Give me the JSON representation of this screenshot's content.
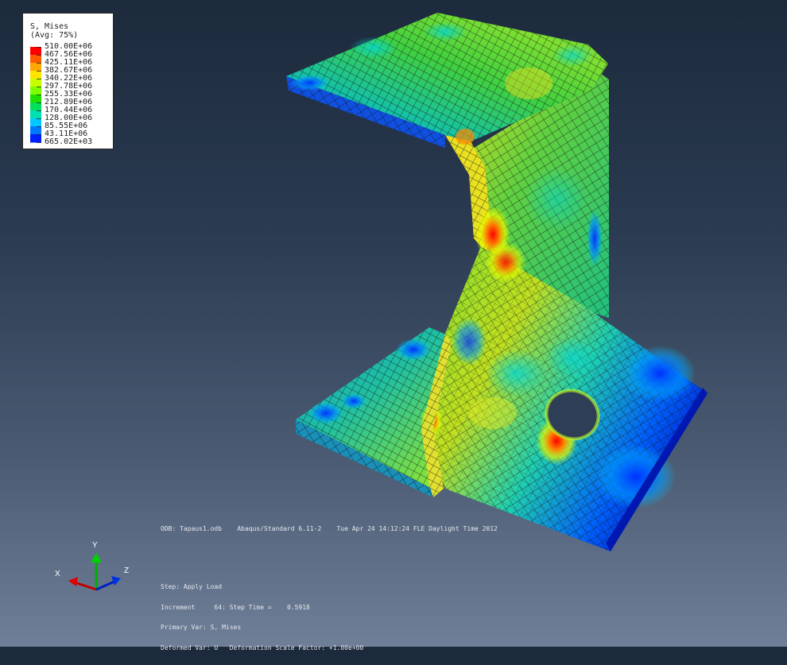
{
  "legend": {
    "title": "S, Mises",
    "subtitle": "(Avg: 75%)",
    "levels": [
      {
        "value": "510.00E+06",
        "color": "#ff0000"
      },
      {
        "value": "467.56E+06",
        "color": "#ff5a00"
      },
      {
        "value": "425.11E+06",
        "color": "#ffa600"
      },
      {
        "value": "382.67E+06",
        "color": "#ffe400"
      },
      {
        "value": "340.22E+06",
        "color": "#c8ff00"
      },
      {
        "value": "297.78E+06",
        "color": "#7cff00"
      },
      {
        "value": "255.33E+06",
        "color": "#1fe000"
      },
      {
        "value": "212.89E+06",
        "color": "#00e05c"
      },
      {
        "value": "170.44E+06",
        "color": "#00e0b0"
      },
      {
        "value": "128.00E+06",
        "color": "#00c8ff"
      },
      {
        "value": "85.55E+06",
        "color": "#0078ff"
      },
      {
        "value": "43.11E+06",
        "color": "#0020ff"
      },
      {
        "value": "665.02E+03",
        "color": "#0000c8"
      }
    ]
  },
  "odb_info": "ODB: Tapaus1.odb    Abaqus/Standard 6.11-2    Tue Apr 24 14:12:24 FLE Daylight Time 2012",
  "step_info": {
    "step": "Step: Apply Load",
    "increment": "Increment     64: Step Time =    0.5918",
    "primary_var": "Primary Var: S, Mises",
    "deformed_var": "Deformed Var: U   Deformation Scale Factor: +1.00e+00"
  },
  "triad": {
    "x": "X",
    "y": "Y",
    "z": "Z"
  }
}
